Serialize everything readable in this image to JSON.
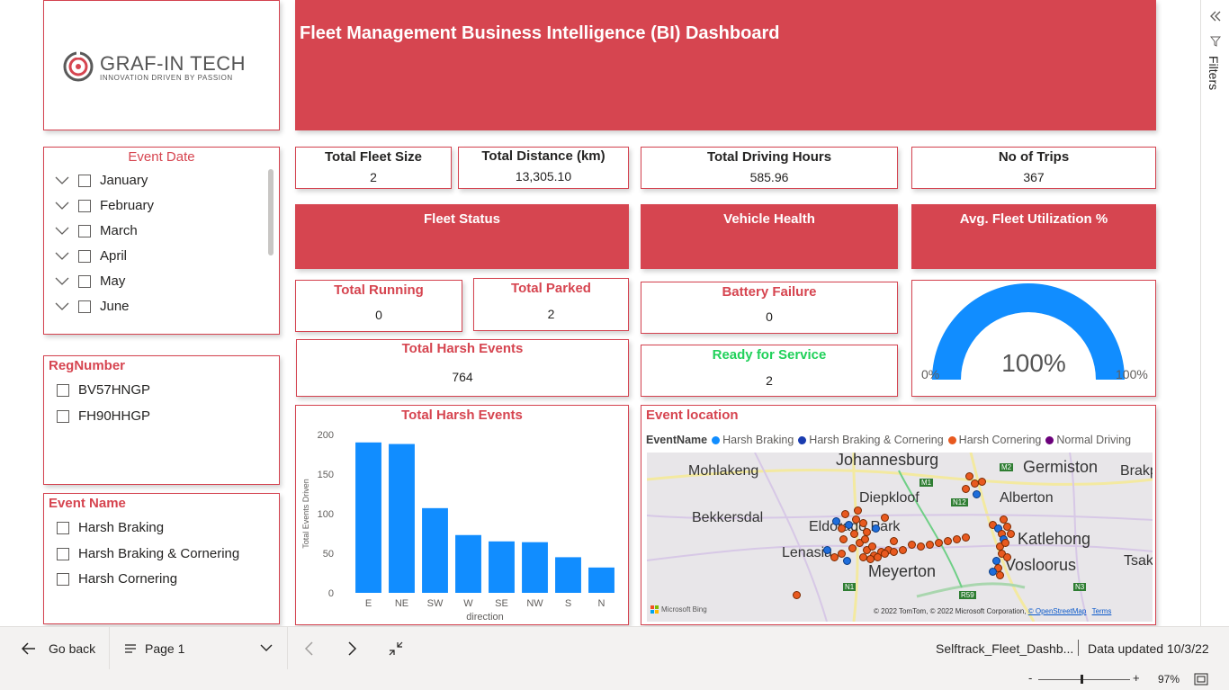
{
  "header": {
    "title": "Fleet Management Business Intelligence (BI) Dashboard",
    "logo_main": "GRAF-IN TECH",
    "logo_tagline": "INNOVATION DRIVEN BY PASSION"
  },
  "colors": {
    "accent": "#d64550",
    "bar": "#118dff",
    "green": "#21d15a",
    "gauge": "#118dff"
  },
  "kpis": {
    "fleet_size": {
      "label": "Total Fleet Size",
      "value": "2"
    },
    "distance": {
      "label": "Total Distance (km)",
      "value": "13,305.10"
    },
    "driving_hours": {
      "label": "Total Driving Hours",
      "value": "585.96"
    },
    "trips": {
      "label": "No of Trips",
      "value": "367"
    },
    "running": {
      "label": "Total Running",
      "value": "0"
    },
    "parked": {
      "label": "Total Parked",
      "value": "2"
    },
    "battery": {
      "label": "Battery Failure",
      "value": "0"
    },
    "harsh": {
      "label": "Total Harsh Events",
      "value": "764"
    },
    "ready": {
      "label": "Ready for Service",
      "value": "2"
    }
  },
  "sections": {
    "fleet_status": "Fleet Status",
    "vehicle_health": "Vehicle Health",
    "utilization": "Avg.  Fleet Utilization %"
  },
  "gauge": {
    "value": "100%",
    "min": "0%",
    "max": "100%",
    "fraction": 1.0
  },
  "slicers": {
    "event_date": {
      "title": "Event Date",
      "items": [
        "January",
        "February",
        "March",
        "April",
        "May",
        "June"
      ]
    },
    "reg_number": {
      "title": "RegNumber",
      "items": [
        "BV57HNGP",
        "FH90HHGP"
      ]
    },
    "event_name": {
      "title": "Event Name",
      "items": [
        "Harsh Braking",
        "Harsh Braking & Cornering",
        "Harsh Cornering"
      ]
    }
  },
  "chart_data": {
    "type": "bar",
    "title": "Total Harsh Events",
    "xlabel": "direction",
    "ylabel": "Total Events Driven",
    "categories": [
      "E",
      "NE",
      "SW",
      "W",
      "SE",
      "NW",
      "S",
      "N"
    ],
    "values": [
      190,
      188,
      107,
      73,
      65,
      64,
      45,
      32
    ],
    "ylim": [
      0,
      200
    ],
    "yticks": [
      0,
      50,
      100,
      150,
      200
    ],
    "grid": false
  },
  "map": {
    "title": "Event location",
    "legend_title": "EventName",
    "legend": [
      {
        "label": "Harsh Braking",
        "color": "#118dff"
      },
      {
        "label": "Harsh Braking & Cornering",
        "color": "#1a3cb0"
      },
      {
        "label": "Harsh Cornering",
        "color": "#e8591f"
      },
      {
        "label": "Normal Driving",
        "color": "#6b007b"
      }
    ],
    "places": [
      "Johannesburg",
      "Germiston",
      "Brakp",
      "Mohlakeng",
      "Diepkloof",
      "Alberton",
      "Bekkersdal",
      "Eldorado Park",
      "Katlehong",
      "Lenasia",
      "Vosloorus",
      "Tsak",
      "Meyerton"
    ],
    "roads": [
      "M1",
      "M2",
      "N12",
      "N1",
      "N3",
      "R59"
    ],
    "bing": "Microsoft Bing",
    "copyright": "© 2022 TomTom, © 2022 Microsoft Corporation,",
    "osm": "© OpenStreetMap",
    "terms": "Terms"
  },
  "sidebar": {
    "filters_label": "Filters"
  },
  "bottombar": {
    "go_back": "Go back",
    "page": "Page 1",
    "file_name": "Selftrack_Fleet_Dashb...",
    "updated": "Data updated 10/3/22",
    "zoom": "97%"
  }
}
